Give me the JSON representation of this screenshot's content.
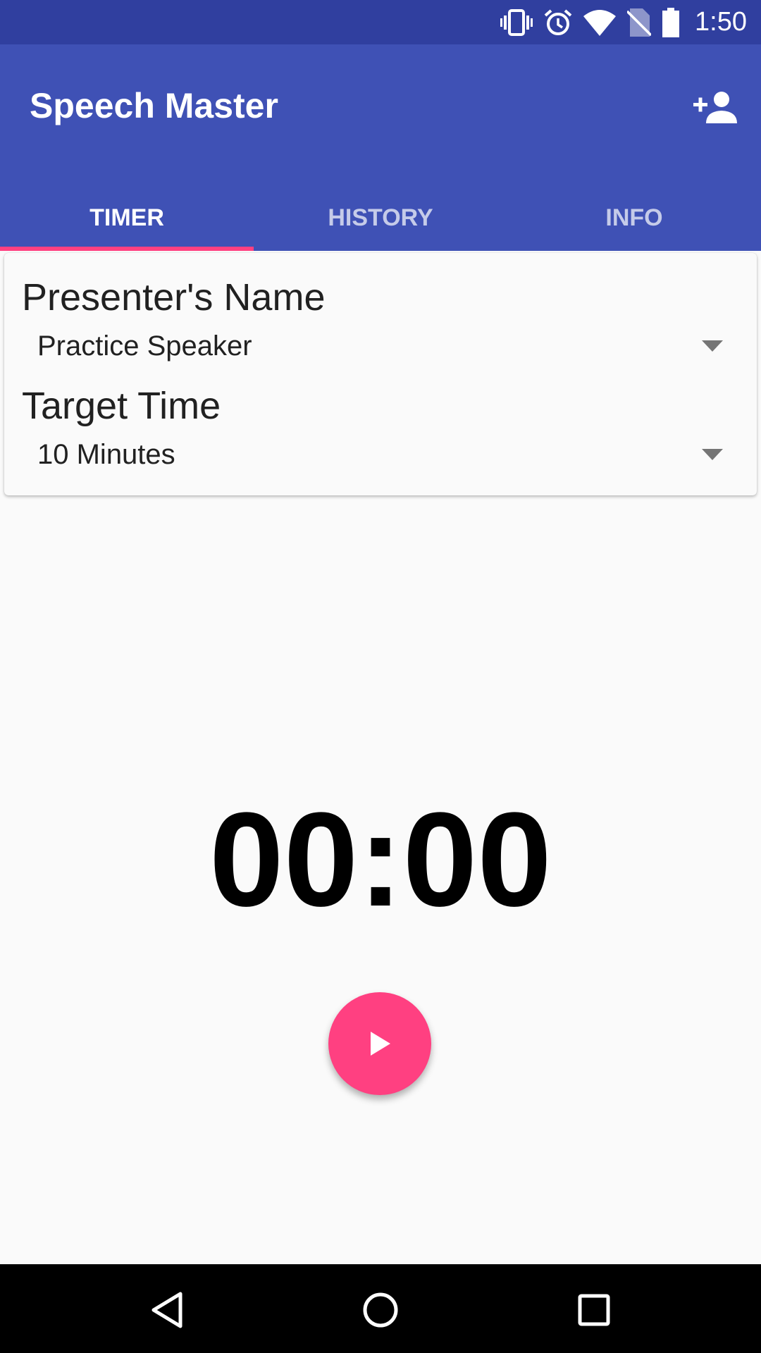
{
  "status_bar": {
    "time": "1:50",
    "icons": [
      "vibrate-icon",
      "alarm-icon",
      "wifi-icon",
      "no-sim-icon",
      "battery-icon"
    ]
  },
  "app_bar": {
    "title": "Speech Master",
    "action_icon": "add-person-icon"
  },
  "tabs": [
    {
      "label": "TIMER",
      "active": true
    },
    {
      "label": "HISTORY",
      "active": false
    },
    {
      "label": "INFO",
      "active": false
    }
  ],
  "form": {
    "presenter_label": "Presenter's Name",
    "presenter_value": "Practice Speaker",
    "target_label": "Target Time",
    "target_value": "10 Minutes"
  },
  "timer": {
    "display": "00:00"
  },
  "fab": {
    "icon": "play-icon"
  },
  "nav_bar": {
    "icons": [
      "back-icon",
      "home-icon",
      "recents-icon"
    ]
  },
  "colors": {
    "status_bar": "#303f9f",
    "primary": "#3f51b5",
    "accent": "#ff4081",
    "background": "#fafafa"
  }
}
